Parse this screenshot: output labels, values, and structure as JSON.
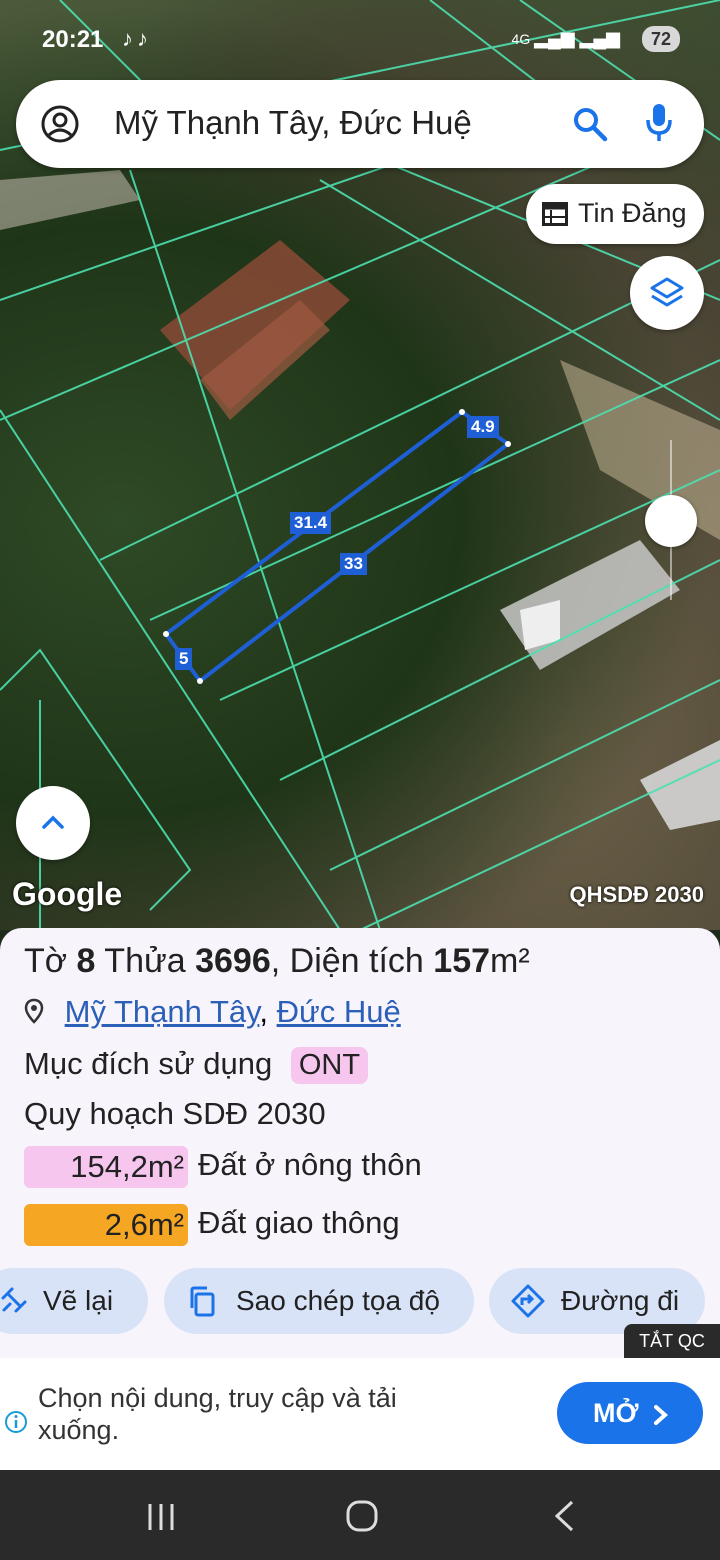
{
  "status_bar": {
    "time": "20:21",
    "apps": "♪♪",
    "network": "4G",
    "battery": "72"
  },
  "search": {
    "query": "Mỹ Thạnh Tây, Đức Huệ",
    "icons": [
      "account-icon",
      "search-icon",
      "microphone-icon"
    ]
  },
  "map": {
    "tin_dang_label": "Tin Đăng",
    "edge_labels": {
      "top": "4.9",
      "upper": "31.4",
      "lower": "33",
      "left": "5"
    },
    "google_logo": "Google",
    "plan_label": "QHSDĐ 2030",
    "colors": {
      "parcel_lines": "#4de0b0",
      "selected_parcel": "#1f5fd6"
    }
  },
  "parcel": {
    "to_label": "Tờ",
    "to_value": "8",
    "thua_label": "Thửa",
    "thua_value": "3696",
    "area_label": ", Diện tích",
    "area_value": "157",
    "area_unit": "m²",
    "location": {
      "commune": "Mỹ Thạnh Tây",
      "district": "Đức Huệ",
      "separator": ","
    },
    "purpose_label": "Mục đích sử dụng",
    "purpose_code": "ONT",
    "plan_title": "Quy hoạch SDĐ 2030",
    "zones": [
      {
        "area": "154,2m²",
        "name": "Đất ở nông thôn",
        "color": "#f7c6ef"
      },
      {
        "area": "2,6m²",
        "name": "Đất giao thông",
        "color": "#f5a623"
      }
    ]
  },
  "actions": {
    "redraw": "Vẽ lại",
    "copy_coords": "Sao chép tọa độ",
    "directions": "Đường đi"
  },
  "ad": {
    "close_label": "TẮT QC",
    "text": "Chọn nội dung, truy cập và tải xuống.",
    "button": "MỞ"
  }
}
